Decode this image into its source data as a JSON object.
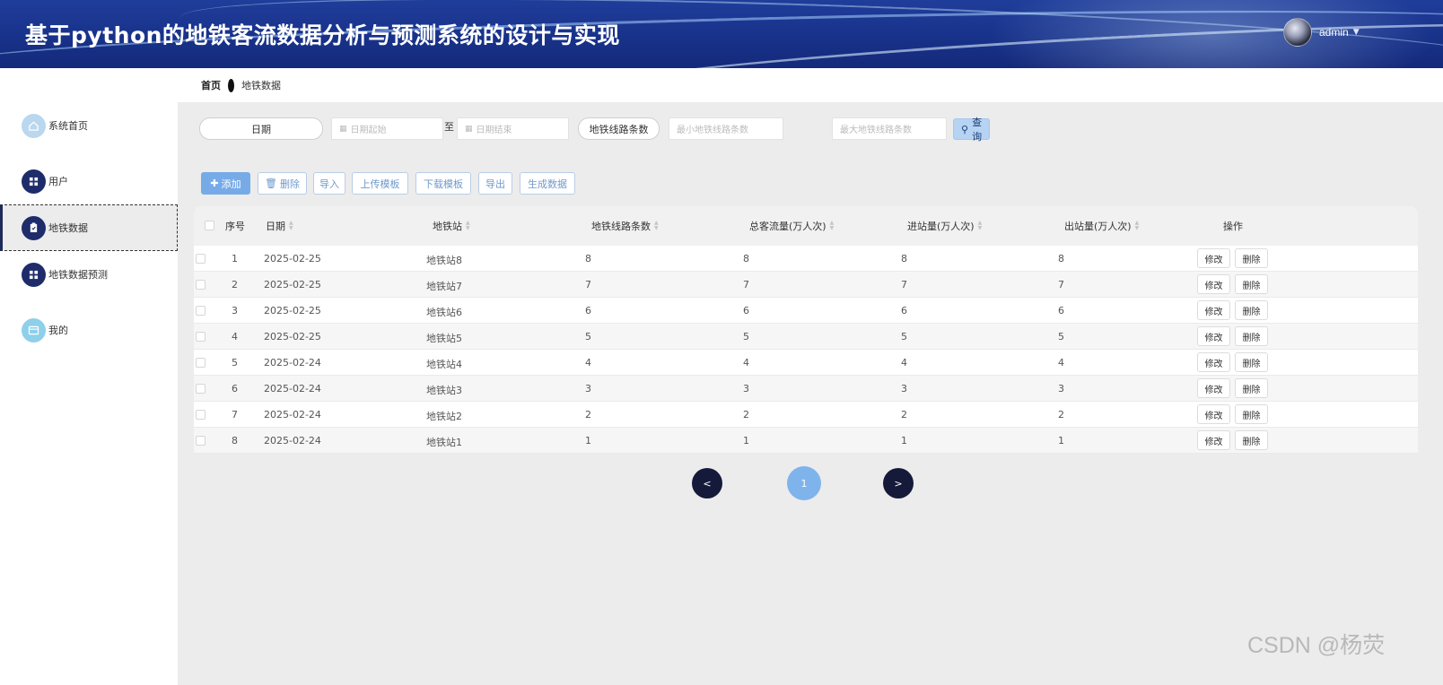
{
  "header": {
    "title": "基于python的地铁客流数据分析与预测系统的设计与实现",
    "user_name": "admin",
    "caret": "▼"
  },
  "breadcrumb": {
    "home": "首页",
    "current": "地铁数据"
  },
  "sidebar": {
    "items": [
      {
        "label": "系统首页",
        "icon": "home-icon"
      },
      {
        "label": "用户",
        "icon": "grid-icon"
      },
      {
        "label": "地铁数据",
        "icon": "clipboard-icon",
        "active": true
      },
      {
        "label": "地铁数据预测",
        "icon": "grid-icon"
      },
      {
        "label": "我的",
        "icon": "card-icon"
      }
    ]
  },
  "search": {
    "date_label": "日期",
    "date_start_placeholder": "日期起始",
    "to_label": "至",
    "date_end_placeholder": "日期结束",
    "lines_label": "地铁线路条数",
    "lines_min_placeholder": "最小地铁线路条数",
    "lines_max_placeholder": "最大地铁线路条数",
    "query_label": "查询"
  },
  "actions": {
    "add": "添加",
    "delete": "删除",
    "import": "导入",
    "upload_template": "上传模板",
    "download_template": "下载模板",
    "export": "导出",
    "generate": "生成数据"
  },
  "table": {
    "headers": {
      "index": "序号",
      "date": "日期",
      "station": "地铁站",
      "lines": "地铁线路条数",
      "total": "总客流量(万人次)",
      "inbound": "进站量(万人次)",
      "outbound": "出站量(万人次)",
      "ops": "操作"
    },
    "edit_label": "修改",
    "delete_label": "删除",
    "rows": [
      {
        "idx": "1",
        "date": "2025-02-25",
        "station": "地铁站8",
        "lines": "8",
        "total": "8",
        "in": "8",
        "out": "8"
      },
      {
        "idx": "2",
        "date": "2025-02-25",
        "station": "地铁站7",
        "lines": "7",
        "total": "7",
        "in": "7",
        "out": "7"
      },
      {
        "idx": "3",
        "date": "2025-02-25",
        "station": "地铁站6",
        "lines": "6",
        "total": "6",
        "in": "6",
        "out": "6"
      },
      {
        "idx": "4",
        "date": "2025-02-25",
        "station": "地铁站5",
        "lines": "5",
        "total": "5",
        "in": "5",
        "out": "5"
      },
      {
        "idx": "5",
        "date": "2025-02-24",
        "station": "地铁站4",
        "lines": "4",
        "total": "4",
        "in": "4",
        "out": "4"
      },
      {
        "idx": "6",
        "date": "2025-02-24",
        "station": "地铁站3",
        "lines": "3",
        "total": "3",
        "in": "3",
        "out": "3"
      },
      {
        "idx": "7",
        "date": "2025-02-24",
        "station": "地铁站2",
        "lines": "2",
        "total": "2",
        "in": "2",
        "out": "2"
      },
      {
        "idx": "8",
        "date": "2025-02-24",
        "station": "地铁站1",
        "lines": "1",
        "total": "1",
        "in": "1",
        "out": "1"
      }
    ]
  },
  "pagination": {
    "prev": "<",
    "current": "1",
    "next": ">"
  },
  "watermark": "CSDN @杨荧",
  "colors": {
    "header_bg": "#1a358c",
    "primary": "#77abe8",
    "nav_dark": "#151a3a"
  }
}
